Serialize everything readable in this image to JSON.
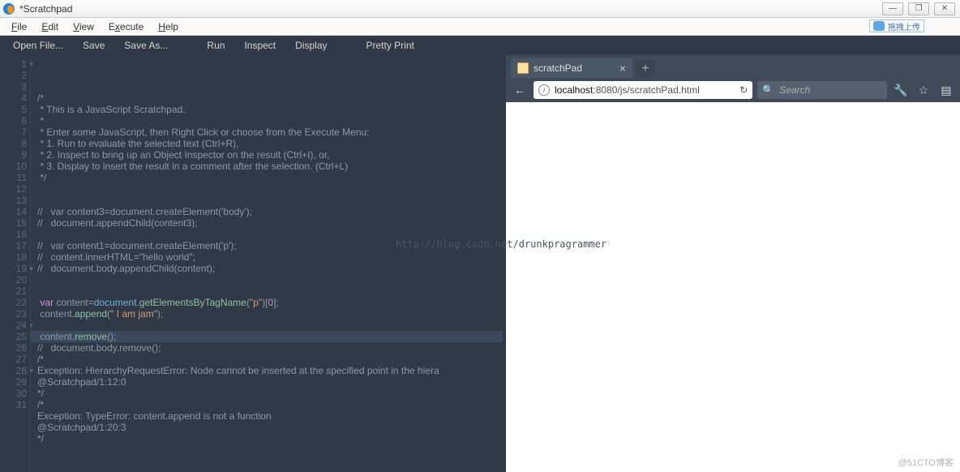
{
  "window": {
    "title": "*Scratchpad"
  },
  "menubar": {
    "items": [
      "File",
      "Edit",
      "View",
      "Execute",
      "Help"
    ],
    "upload": "拖拽上传"
  },
  "toolbar": {
    "items": [
      "Open File...",
      "Save",
      "Save As...",
      "",
      "Run",
      "Inspect",
      "Display",
      "",
      "Pretty Print"
    ]
  },
  "editor": {
    "lines": [
      {
        "n": 1,
        "m": 1,
        "segs": [
          {
            "t": "/*",
            "c": ""
          }
        ]
      },
      {
        "n": 2,
        "segs": [
          {
            "t": " * This is a JavaScript Scratchpad.",
            "c": ""
          }
        ]
      },
      {
        "n": 3,
        "segs": [
          {
            "t": " *",
            "c": ""
          }
        ]
      },
      {
        "n": 4,
        "segs": [
          {
            "t": " * Enter some JavaScript, then Right Click or choose from the Execute Menu:",
            "c": ""
          }
        ]
      },
      {
        "n": 5,
        "segs": [
          {
            "t": " * 1. Run to evaluate the selected text (Ctrl+R),",
            "c": ""
          }
        ]
      },
      {
        "n": 6,
        "segs": [
          {
            "t": " * 2. Inspect to bring up an Object Inspector on the result (Ctrl+I), or,",
            "c": ""
          }
        ]
      },
      {
        "n": 7,
        "segs": [
          {
            "t": " * 3. Display to insert the result in a comment after the selection. (Ctrl+L)",
            "c": ""
          }
        ]
      },
      {
        "n": 8,
        "segs": [
          {
            "t": " */",
            "c": ""
          }
        ]
      },
      {
        "n": 9,
        "segs": [
          {
            "t": "",
            "c": ""
          }
        ]
      },
      {
        "n": 10,
        "segs": [
          {
            "t": "",
            "c": ""
          }
        ]
      },
      {
        "n": 11,
        "segs": [
          {
            "t": "//   var content3=document.createElement('body');",
            "c": ""
          }
        ]
      },
      {
        "n": 12,
        "segs": [
          {
            "t": "//   document.appendChild(content3);",
            "c": ""
          }
        ]
      },
      {
        "n": 13,
        "segs": [
          {
            "t": "",
            "c": ""
          }
        ]
      },
      {
        "n": 14,
        "segs": [
          {
            "t": "//   var content1=document.createElement('p');",
            "c": ""
          }
        ]
      },
      {
        "n": 15,
        "segs": [
          {
            "t": "//   content.innerHTML=\"hello world\";",
            "c": ""
          }
        ]
      },
      {
        "n": 16,
        "segs": [
          {
            "t": "//   document.body.appendChild(content);",
            "c": ""
          }
        ]
      },
      {
        "n": 17,
        "segs": [
          {
            "t": "",
            "c": ""
          }
        ]
      },
      {
        "n": 18,
        "segs": [
          {
            "t": "",
            "c": ""
          }
        ]
      },
      {
        "n": 19,
        "m": 1,
        "segs": [
          {
            "t": " ",
            "c": ""
          },
          {
            "t": "var",
            "c": "kw"
          },
          {
            "t": " content",
            "c": ""
          },
          {
            "t": "=",
            "c": ""
          },
          {
            "t": "document",
            "c": "ident"
          },
          {
            "t": ".",
            "c": ""
          },
          {
            "t": "getElementsByTagName",
            "c": "meth"
          },
          {
            "t": "(",
            "c": ""
          },
          {
            "t": "\"p\"",
            "c": "str"
          },
          {
            "t": ")[",
            "c": ""
          },
          {
            "t": "0",
            "c": "num"
          },
          {
            "t": "];",
            "c": ""
          }
        ]
      },
      {
        "n": 20,
        "segs": [
          {
            "t": " content",
            "c": ""
          },
          {
            "t": ".",
            "c": ""
          },
          {
            "t": "append",
            "c": "meth"
          },
          {
            "t": "(",
            "c": ""
          },
          {
            "t": "\" I am jam\"",
            "c": "str"
          },
          {
            "t": ");",
            "c": ""
          }
        ]
      },
      {
        "n": 21,
        "segs": [
          {
            "t": "",
            "c": ""
          }
        ]
      },
      {
        "n": 22,
        "hl": 1,
        "segs": [
          {
            "t": " content",
            "c": ""
          },
          {
            "t": ".",
            "c": ""
          },
          {
            "t": "remove",
            "c": "meth"
          },
          {
            "t": "();",
            "c": ""
          }
        ]
      },
      {
        "n": 23,
        "segs": [
          {
            "t": "//   document.body.remove();",
            "c": ""
          }
        ]
      },
      {
        "n": 24,
        "m": 1,
        "segs": [
          {
            "t": "/*",
            "c": ""
          }
        ]
      },
      {
        "n": 25,
        "segs": [
          {
            "t": "Exception: HierarchyRequestError: Node cannot be inserted at the specified point in the hiera",
            "c": ""
          }
        ]
      },
      {
        "n": 26,
        "segs": [
          {
            "t": "@Scratchpad/1:12:0",
            "c": ""
          }
        ]
      },
      {
        "n": 27,
        "segs": [
          {
            "t": "*/",
            "c": ""
          }
        ]
      },
      {
        "n": 28,
        "m": 1,
        "segs": [
          {
            "t": "/*",
            "c": ""
          }
        ]
      },
      {
        "n": 29,
        "segs": [
          {
            "t": "Exception: TypeError: content.append is not a function",
            "c": ""
          }
        ]
      },
      {
        "n": 30,
        "segs": [
          {
            "t": "@Scratchpad/1:20:3",
            "c": ""
          }
        ]
      },
      {
        "n": 31,
        "segs": [
          {
            "t": "*/",
            "c": ""
          }
        ]
      }
    ],
    "watermark": "http://blog.csdn.net/drunkpragrammer"
  },
  "browser": {
    "tab": {
      "title": "scratchPad"
    },
    "url": {
      "host": "localhost",
      "rest": ":8080/js/scratchPad.html"
    },
    "search_placeholder": "Search",
    "reload_icon": "↻"
  },
  "footer": "@51CTO博客"
}
